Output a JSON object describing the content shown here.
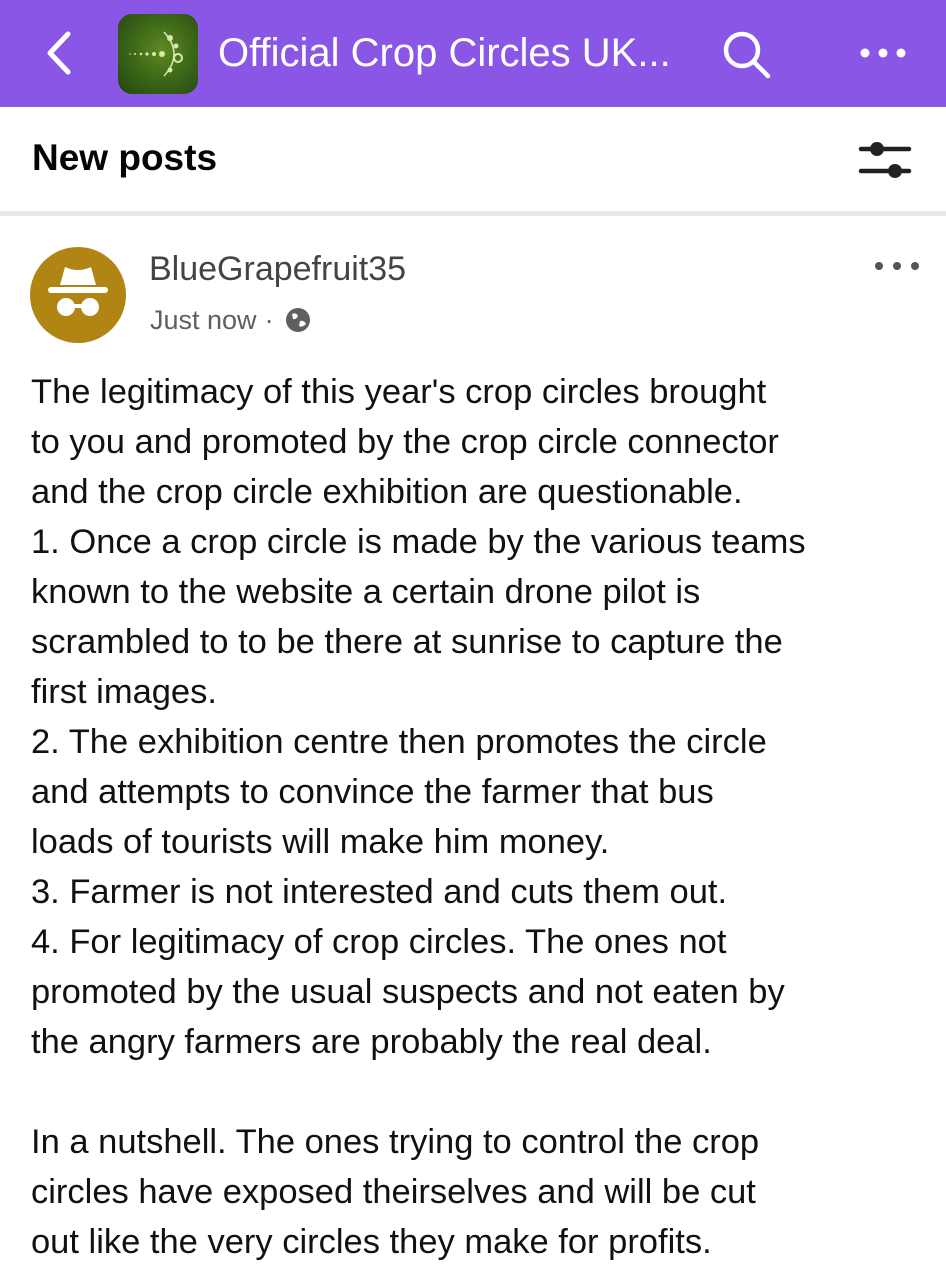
{
  "header": {
    "group_title": "Official Crop Circles UK...",
    "icons": [
      "back-arrow-icon",
      "group-icon",
      "search-icon",
      "more-icon"
    ],
    "bar_color": "#8a56e6"
  },
  "subheader": {
    "title": "New posts",
    "icon": "filter-sliders-icon"
  },
  "post": {
    "author": "BlueGrapefruit35",
    "time": "Just now",
    "separator": "·",
    "privacy_icon": "globe-icon",
    "avatar_icon": "incognito-icon",
    "avatar_color": "#b08514",
    "lines": [
      "The legitimacy of this year's crop circles brought",
      "to you and promoted by the crop circle connector",
      "and the crop circle exhibition are questionable.",
      "1. Once a crop circle is made by the various teams",
      "known to the website a certain drone pilot is",
      "scrambled to to be there at sunrise to capture the",
      "first images.",
      "2. The exhibition centre then promotes the circle",
      "and attempts to convince the farmer that bus",
      "loads of tourists will make him money.",
      "3. Farmer is not interested and cuts them out.",
      "4. For legitimacy of crop circles.  The ones not",
      "promoted by the usual suspects and not eaten by",
      "the angry farmers are probably the real deal.",
      "",
      "In a nutshell.  The ones trying to control the crop",
      "circles have exposed theirselves and will be cut",
      "out like the very circles they make for profits."
    ]
  }
}
